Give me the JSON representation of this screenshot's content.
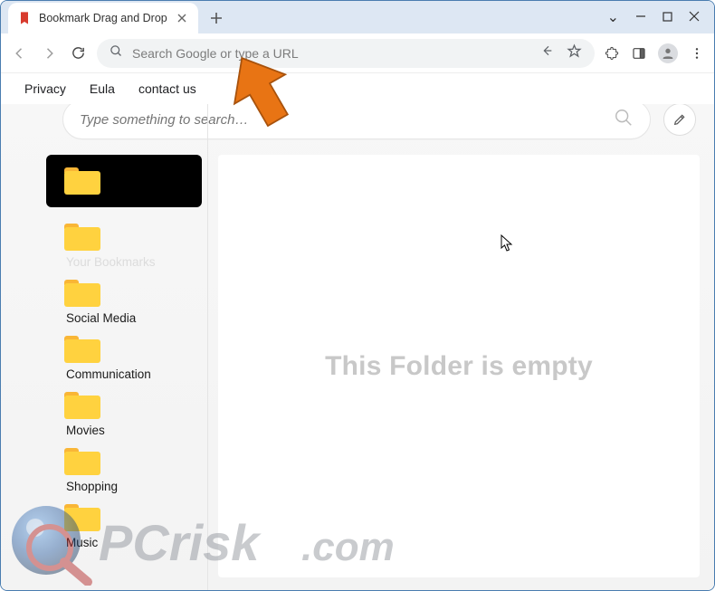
{
  "window": {
    "tab_title": "Bookmark Drag and Drop"
  },
  "omnibox": {
    "placeholder": "Search Google or type a URL"
  },
  "bookmarks_bar": {
    "links": [
      "Privacy",
      "Eula",
      "contact us"
    ]
  },
  "page": {
    "search_placeholder": "Type something to search…",
    "empty_message": "This Folder is empty"
  },
  "sidebar": {
    "folders": [
      {
        "label": "",
        "active": true
      },
      {
        "label": "Your Bookmarks",
        "ghost": true
      },
      {
        "label": "Social Media"
      },
      {
        "label": "Communication"
      },
      {
        "label": "Movies"
      },
      {
        "label": "Shopping"
      },
      {
        "label": "Music"
      }
    ]
  },
  "watermark": {
    "text": "PCrisk.com"
  }
}
